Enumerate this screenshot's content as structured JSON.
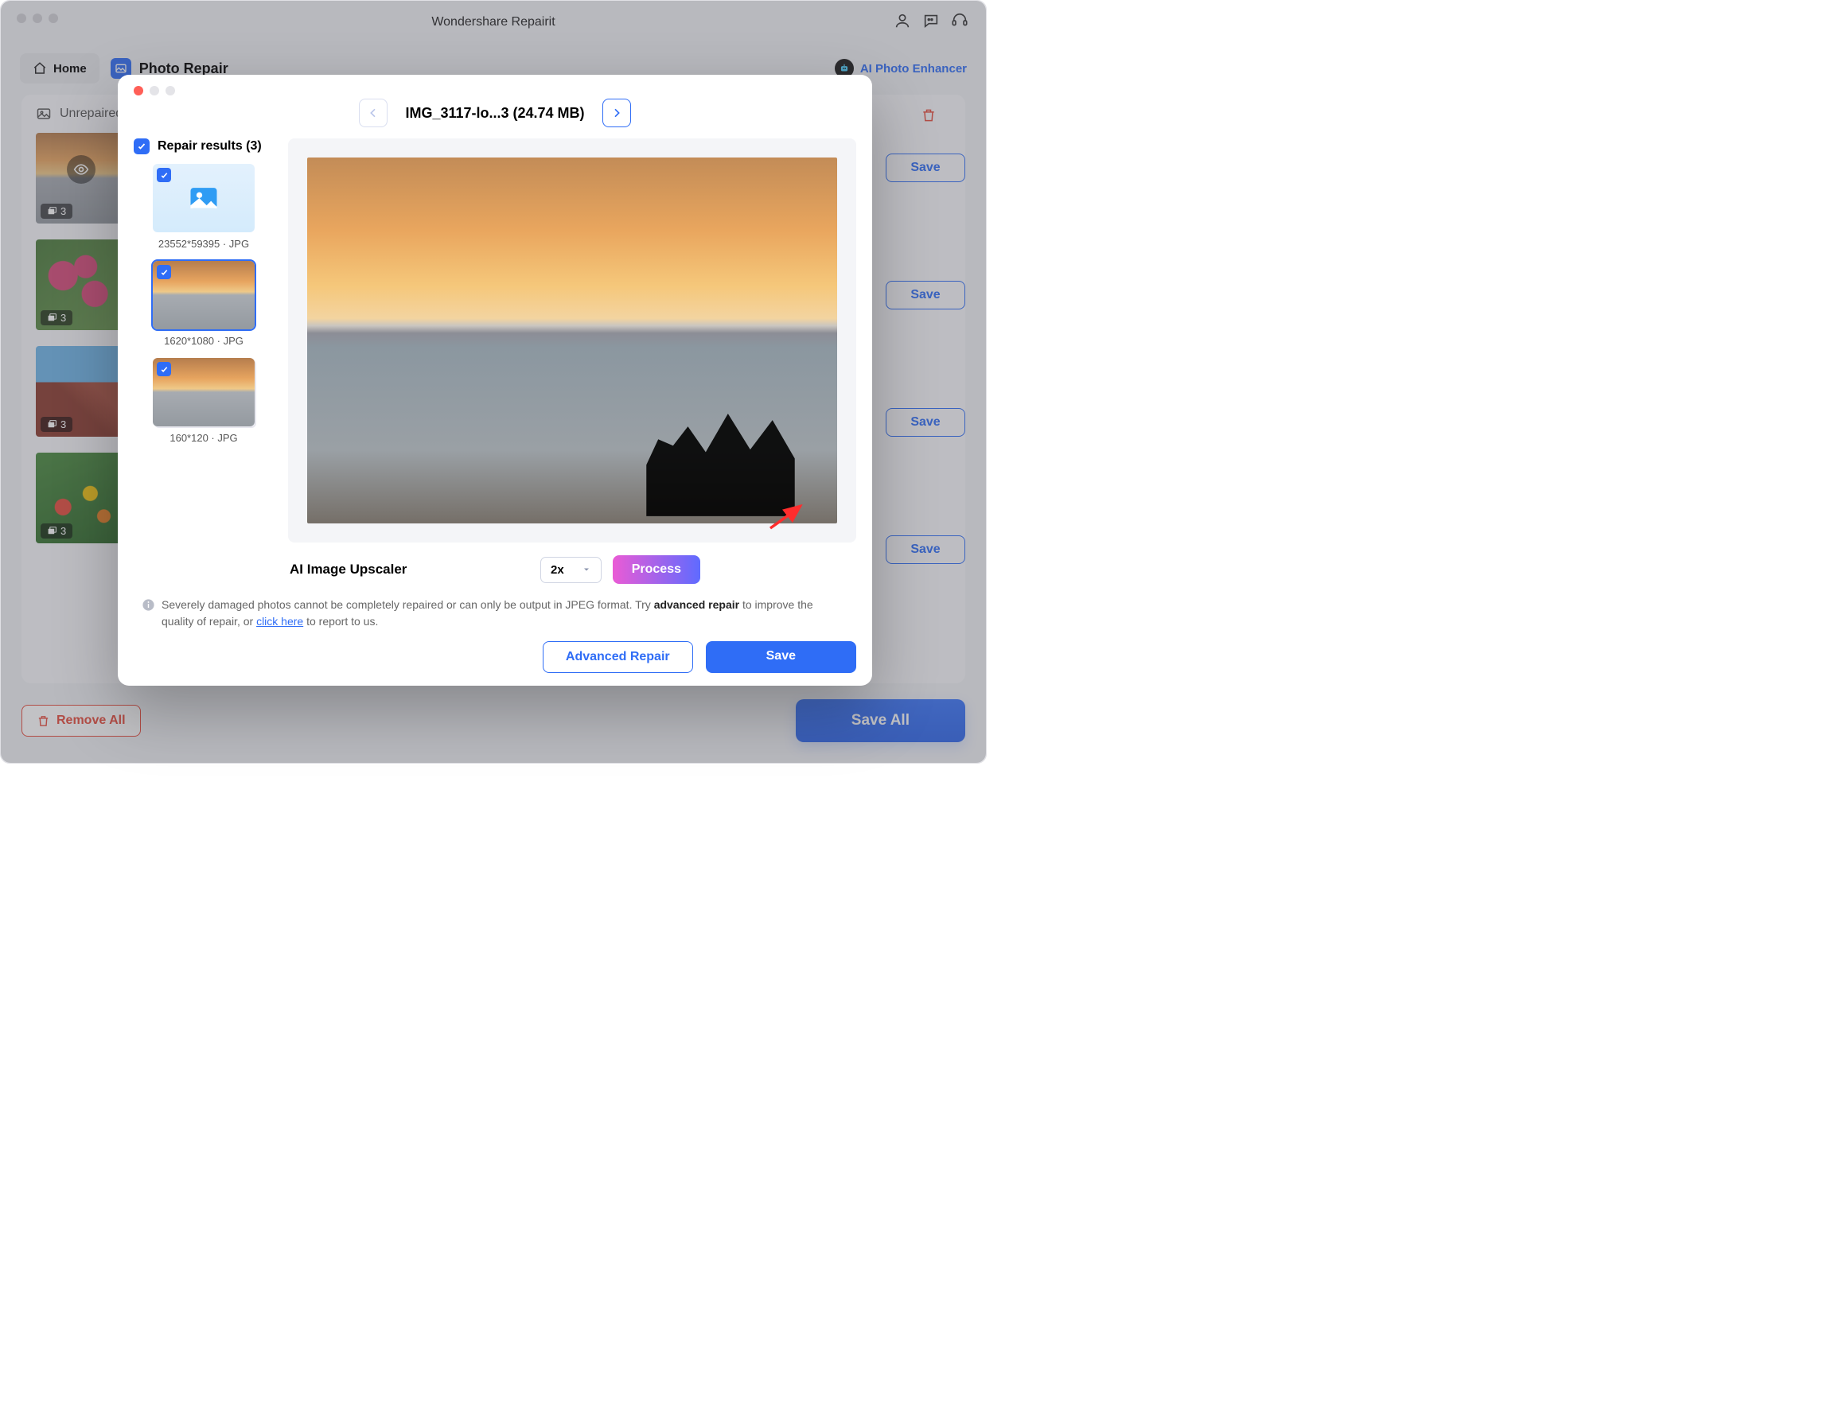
{
  "app": {
    "title": "Wondershare Repairit"
  },
  "toolbar": {
    "home": "Home",
    "section": "Photo Repair",
    "ai_enhancer": "AI Photo Enhancer"
  },
  "panel": {
    "unrepaired": "Unrepaired",
    "thumbs": [
      {
        "count": "3",
        "save": "Save",
        "kind": "sunset"
      },
      {
        "count": "3",
        "save": "Save",
        "kind": "flowers"
      },
      {
        "count": "3",
        "save": "Save",
        "kind": "building"
      },
      {
        "count": "3",
        "save": "Save",
        "kind": "garden"
      }
    ]
  },
  "footer": {
    "remove_all": "Remove All",
    "save_all": "Save All"
  },
  "modal": {
    "file_title": "IMG_3117-lo...3 (24.74 MB)",
    "repair_results_label": "Repair results (3)",
    "results": [
      {
        "caption": "23552*59395 · JPG",
        "selected": false,
        "placeholder": true
      },
      {
        "caption": "1620*1080 · JPG",
        "selected": true,
        "placeholder": false
      },
      {
        "caption": "160*120 · JPG",
        "selected": false,
        "placeholder": false
      }
    ],
    "upscaler_label": "AI Image Upscaler",
    "scale_value": "2x",
    "process": "Process",
    "note_pre": "Severely damaged photos cannot be completely repaired or can only be output in JPEG format. Try ",
    "note_bold": "advanced repair",
    "note_mid": " to improve the quality of repair, or ",
    "note_link": "click here",
    "note_post": " to report to us.",
    "advanced_repair": "Advanced Repair",
    "save": "Save"
  }
}
